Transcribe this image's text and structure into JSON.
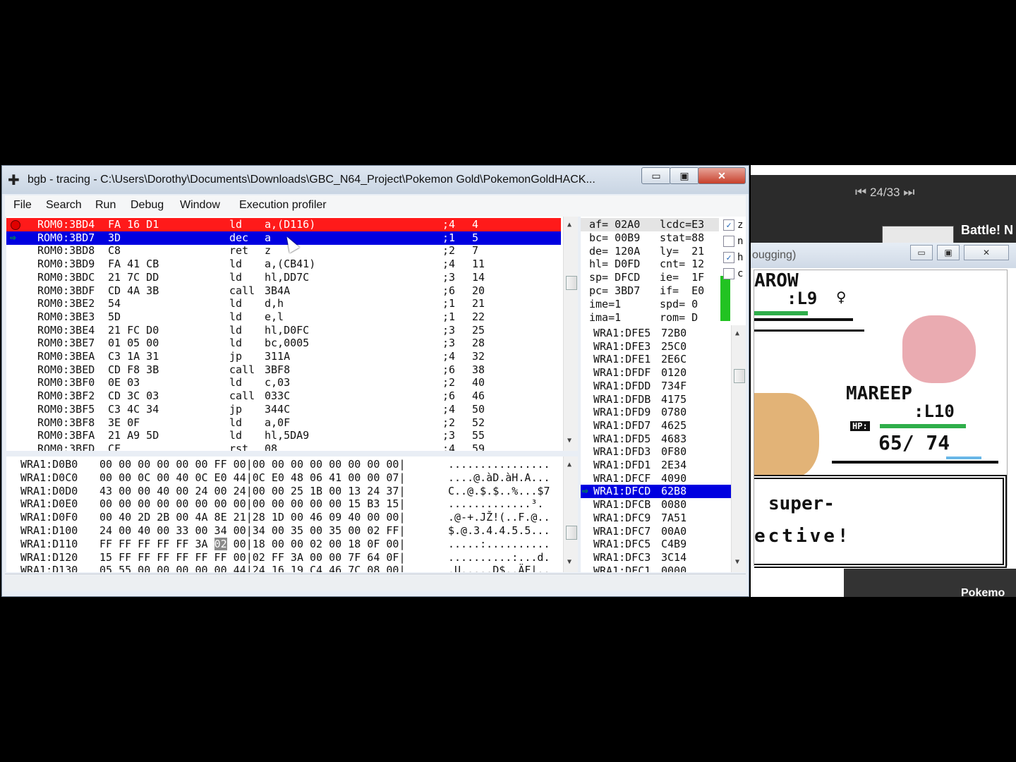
{
  "background_app": {
    "pager": "24/33",
    "tab_label": "Battle! N",
    "bottom_label": "Pokemo"
  },
  "emulator": {
    "title_fragment": "ougging)",
    "enemy_name": "AROW",
    "enemy_level": ":L9",
    "enemy_gender": "♀",
    "player_name": "MAREEP",
    "player_level": ":L10",
    "player_hp_label": "HP:",
    "player_hp": "65/ 74",
    "dialog_line1": "super-",
    "dialog_line2": "ective!"
  },
  "window": {
    "title": "bgb - tracing - C:\\Users\\Dorothy\\Documents\\Downloads\\GBC_N64_Project\\Pokemon Gold\\PokemonGoldHACK...",
    "minimize": "▭",
    "maximize": "▣",
    "close": "✕"
  },
  "menu": [
    "File",
    "Search",
    "Run",
    "Debug",
    "Window",
    "Execution profiler"
  ],
  "disassembly": [
    {
      "addr": "ROM0:3BD4",
      "bytes": "FA 16 D1",
      "mn": "ld",
      "op": "a,(D116)",
      "cyc": ";4",
      "tot": "4",
      "state": "breakpoint"
    },
    {
      "addr": "ROM0:3BD7",
      "bytes": "3D",
      "mn": "dec",
      "op": "a",
      "cyc": ";1",
      "tot": "5",
      "state": "pc"
    },
    {
      "addr": "ROM0:3BD8",
      "bytes": "C8",
      "mn": "ret",
      "op": "z",
      "cyc": ";2",
      "tot": "7",
      "state": ""
    },
    {
      "addr": "ROM0:3BD9",
      "bytes": "FA 41 CB",
      "mn": "ld",
      "op": "a,(CB41)",
      "cyc": ";4",
      "tot": "11",
      "state": ""
    },
    {
      "addr": "ROM0:3BDC",
      "bytes": "21 7C DD",
      "mn": "ld",
      "op": "hl,DD7C",
      "cyc": ";3",
      "tot": "14",
      "state": ""
    },
    {
      "addr": "ROM0:3BDF",
      "bytes": "CD 4A 3B",
      "mn": "call",
      "op": "3B4A",
      "cyc": ";6",
      "tot": "20",
      "state": ""
    },
    {
      "addr": "ROM0:3BE2",
      "bytes": "54",
      "mn": "ld",
      "op": "d,h",
      "cyc": ";1",
      "tot": "21",
      "state": ""
    },
    {
      "addr": "ROM0:3BE3",
      "bytes": "5D",
      "mn": "ld",
      "op": "e,l",
      "cyc": ";1",
      "tot": "22",
      "state": ""
    },
    {
      "addr": "ROM0:3BE4",
      "bytes": "21 FC D0",
      "mn": "ld",
      "op": "hl,D0FC",
      "cyc": ";3",
      "tot": "25",
      "state": ""
    },
    {
      "addr": "ROM0:3BE7",
      "bytes": "01 05 00",
      "mn": "ld",
      "op": "bc,0005",
      "cyc": ";3",
      "tot": "28",
      "state": ""
    },
    {
      "addr": "ROM0:3BEA",
      "bytes": "C3 1A 31",
      "mn": "jp",
      "op": "311A",
      "cyc": ";4",
      "tot": "32",
      "state": ""
    },
    {
      "addr": "ROM0:3BED",
      "bytes": "CD F8 3B",
      "mn": "call",
      "op": "3BF8",
      "cyc": ";6",
      "tot": "38",
      "state": ""
    },
    {
      "addr": "ROM0:3BF0",
      "bytes": "0E 03",
      "mn": "ld",
      "op": "c,03",
      "cyc": ";2",
      "tot": "40",
      "state": ""
    },
    {
      "addr": "ROM0:3BF2",
      "bytes": "CD 3C 03",
      "mn": "call",
      "op": "033C",
      "cyc": ";6",
      "tot": "46",
      "state": ""
    },
    {
      "addr": "ROM0:3BF5",
      "bytes": "C3 4C 34",
      "mn": "jp",
      "op": "344C",
      "cyc": ";4",
      "tot": "50",
      "state": ""
    },
    {
      "addr": "ROM0:3BF8",
      "bytes": "3E 0F",
      "mn": "ld",
      "op": "a,0F",
      "cyc": ";2",
      "tot": "52",
      "state": ""
    },
    {
      "addr": "ROM0:3BFA",
      "bytes": "21 A9 5D",
      "mn": "ld",
      "op": "hl,5DA9",
      "cyc": ";3",
      "tot": "55",
      "state": ""
    },
    {
      "addr": "ROM0:3BFD",
      "bytes": "CF",
      "mn": "rst",
      "op": "08",
      "cyc": ";4",
      "tot": "59",
      "state": ""
    }
  ],
  "memory": [
    {
      "addr": "WRA1:D0B0",
      "hex": "00 00 00 00 00 00 FF 00|00 00 00 00 00 00 00 00|",
      "ascii": "................"
    },
    {
      "addr": "WRA1:D0C0",
      "hex": "00 00 0C 00 40 0C E0 44|0C E0 48 06 41 00 00 07|",
      "ascii": "....@.àD.àH.A..."
    },
    {
      "addr": "WRA1:D0D0",
      "hex": "43 00 00 40 00 24 00 24|00 00 25 1B 00 13 24 37|",
      "ascii": "C..@.$.$..%...$7"
    },
    {
      "addr": "WRA1:D0E0",
      "hex": "00 00 00 00 00 00 00 00|00 00 00 00 00 15 B3 15|",
      "ascii": ".............³."
    },
    {
      "addr": "WRA1:D0F0",
      "hex": "00 40 2D 2B 00 4A 8E 21|28 1D 00 46 09 40 00 00|",
      "ascii": ".@-+.JŽ!(..F.@.."
    },
    {
      "addr": "WRA1:D100",
      "hex": "24 00 40 00 33 00 34 00|34 00 35 00 35 00 02 FF|",
      "ascii": "$.@.3.4.4.5.5..."
    },
    {
      "addr": "WRA1:D110",
      "hex": "FF FF FF FF FF 3A 02 00|18 00 00 02 00 18 0F 00|",
      "ascii": ".....:.........."
    },
    {
      "addr": "WRA1:D120",
      "hex": "15 FF FF FF FF FF FF 00|02 FF 3A 00 00 7F 64 0F|",
      "ascii": "..........:...d."
    },
    {
      "addr": "WRA1:D130",
      "hex": "05 55 00 00 00 00 00 44|24 16 19 C4 46 7C 08 00|",
      "ascii": ".U.....D$..ÄF|.."
    }
  ],
  "registers": [
    {
      "l": "af= 02A0",
      "r": "lcdc=E3"
    },
    {
      "l": "bc= 00B9",
      "r": "stat=88"
    },
    {
      "l": "de= 120A",
      "r": "ly=  21"
    },
    {
      "l": "hl= D0FD",
      "r": "cnt= 12"
    },
    {
      "l": "sp= DFCD",
      "r": "ie=  1F"
    },
    {
      "l": "pc= 3BD7",
      "r": "if=  E0"
    },
    {
      "l": "ime=1",
      "r": "spd= 0"
    },
    {
      "l": "ima=1",
      "r": "rom= D"
    }
  ],
  "flags": [
    {
      "name": "z",
      "checked": "✓"
    },
    {
      "name": "n",
      "checked": ""
    },
    {
      "name": "h",
      "checked": "✓"
    },
    {
      "name": "c",
      "checked": ""
    }
  ],
  "stack": [
    {
      "addr": "WRA1:DFE5",
      "val": "72B0",
      "sel": false
    },
    {
      "addr": "WRA1:DFE3",
      "val": "25C0",
      "sel": false
    },
    {
      "addr": "WRA1:DFE1",
      "val": "2E6C",
      "sel": false
    },
    {
      "addr": "WRA1:DFDF",
      "val": "0120",
      "sel": false
    },
    {
      "addr": "WRA1:DFDD",
      "val": "734F",
      "sel": false
    },
    {
      "addr": "WRA1:DFDB",
      "val": "4175",
      "sel": false
    },
    {
      "addr": "WRA1:DFD9",
      "val": "0780",
      "sel": false
    },
    {
      "addr": "WRA1:DFD7",
      "val": "4625",
      "sel": false
    },
    {
      "addr": "WRA1:DFD5",
      "val": "4683",
      "sel": false
    },
    {
      "addr": "WRA1:DFD3",
      "val": "0F80",
      "sel": false
    },
    {
      "addr": "WRA1:DFD1",
      "val": "2E34",
      "sel": false
    },
    {
      "addr": "WRA1:DFCF",
      "val": "4090",
      "sel": false
    },
    {
      "addr": "WRA1:DFCD",
      "val": "62B8",
      "sel": true
    },
    {
      "addr": "WRA1:DFCB",
      "val": "0080",
      "sel": false
    },
    {
      "addr": "WRA1:DFC9",
      "val": "7A51",
      "sel": false
    },
    {
      "addr": "WRA1:DFC7",
      "val": "00A0",
      "sel": false
    },
    {
      "addr": "WRA1:DFC5",
      "val": "C4B9",
      "sel": false
    },
    {
      "addr": "WRA1:DFC3",
      "val": "3C14",
      "sel": false
    },
    {
      "addr": "WRA1:DFC1",
      "val": "0000",
      "sel": false
    }
  ],
  "colors": {
    "breakpoint_row": "#ff1a1a",
    "pc_row": "#0000e0",
    "status_bar_green": "#22c322"
  }
}
